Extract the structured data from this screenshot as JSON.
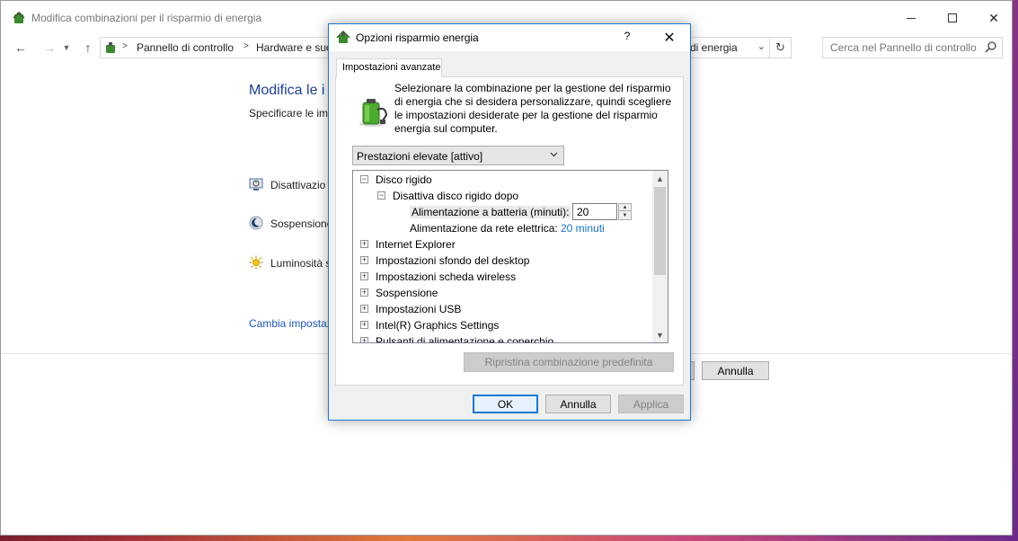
{
  "window": {
    "title": "Modifica combinazioni per il risparmio di energia",
    "minimize_icon": "minimize-icon",
    "maximize_icon": "maximize-icon",
    "close_icon": "close-icon"
  },
  "address_bar": {
    "breadcrumbs": [
      "Pannello di controllo",
      "Hardware e suo",
      "di energia"
    ],
    "search_placeholder": "Cerca nel Pannello di controllo"
  },
  "main": {
    "heading": "Modifica le i",
    "subheading": "Specificare le imp",
    "settings": [
      {
        "label": "Disattivazio",
        "icon": "display-off-icon"
      },
      {
        "label": "Sospensione",
        "icon": "sleep-moon-icon"
      },
      {
        "label": "Luminosità s",
        "icon": "brightness-sun-icon"
      }
    ],
    "link": "Cambia impostaz",
    "cancel_button": "Annulla"
  },
  "dialog": {
    "title": "Opzioni risparmio energia",
    "help": "?",
    "tab": "Impostazioni avanzate",
    "description": "Selezionare la combinazione per la gestione del risparmio di energia che si desidera personalizzare, quindi scegliere le impostazioni desiderate per la gestione del risparmio energia sul computer.",
    "plan_select": "Prestazioni elevate [attivo]",
    "tree": {
      "disk": {
        "label": "Disco rigido",
        "expander": "⊟"
      },
      "disk_sub": {
        "label": "Disattiva disco rigido dopo",
        "expander": "⊟"
      },
      "battery_label": "Alimentazione a batteria (minuti):",
      "battery_value": "20",
      "mains_label": "Alimentazione da rete elettrica:",
      "mains_value": "20 minuti",
      "items": [
        "Internet Explorer",
        "Impostazioni sfondo del desktop",
        "Impostazioni scheda wireless",
        "Sospensione",
        "Impostazioni USB",
        "Intel(R) Graphics Settings",
        "Pulsanti di alimentazione e coperchio"
      ]
    },
    "restore_button": "Ripristina combinazione predefinita",
    "ok_button": "OK",
    "cancel_button": "Annulla",
    "apply_button": "Applica"
  },
  "colors": {
    "accent": "#1b78d0",
    "link": "#1e5bb8",
    "heading": "#1e3f94"
  }
}
